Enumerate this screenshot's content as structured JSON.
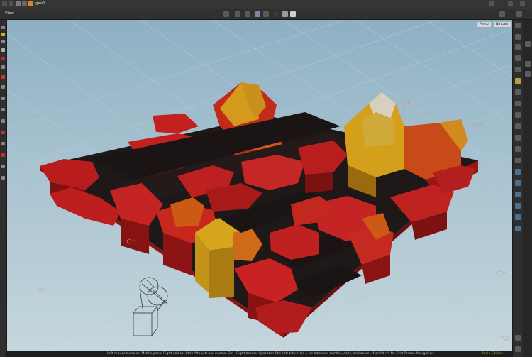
{
  "topbar": {
    "tab_label": "geo1",
    "icons": [
      "nav-back-icon",
      "nav-forward-icon",
      "home-icon",
      "object-path-icon",
      "geo-node-icon"
    ],
    "right_icons": [
      "pin-icon",
      "split-view-icon",
      "menu-icon"
    ]
  },
  "viewbar": {
    "label": "View",
    "tool_icons": [
      "select-icon",
      "transform-icon",
      "rotate-icon",
      "handle-icon",
      "snap-icon",
      "visibility-icon",
      "record-icon",
      "lock-icon",
      "camera-icon"
    ],
    "right_icons": [
      "display-options-icon",
      "settings-icon"
    ]
  },
  "viewport": {
    "persp_label": "Persp",
    "cam_label": "No cam",
    "grid_marker_labels": [
      "+0",
      "+0",
      "+0",
      "+0",
      "+0",
      "+0"
    ]
  },
  "statusbar": {
    "message": "Left mouse tumbles. Middle pans. Right dollies. Ctrl+Alt+Left box zooms. Ctrl+Right zooms. Spacebar-Ctrl-Left tilts. Hold L for alternate tumble, dolly, and zoom.    M or Alt+M for First Person Navigation.",
    "badge": "Indie Edition"
  },
  "colors": {
    "viewport_top": "#8eb0c4",
    "viewport_bottom": "#c5d6dc",
    "ui_dark": "#2b2b2b",
    "heat_dark": "#1e1a1a",
    "heat_red": "#b01818",
    "heat_orange": "#cc4a14",
    "heat_yellow": "#d3a21a",
    "heat_white": "#d8d0c0"
  }
}
